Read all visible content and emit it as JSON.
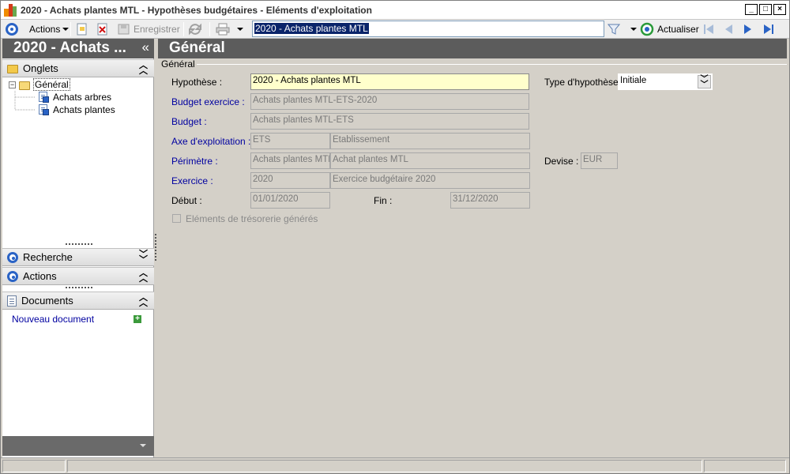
{
  "window": {
    "title": "2020 - Achats plantes MTL -  Hypothèses budgétaires - Eléments d'exploitation"
  },
  "toolbar": {
    "actions_label": "Actions",
    "save_label": "Enregistrer",
    "record_value": "2020 - Achats plantes MTL",
    "refresh_label": "Actualiser"
  },
  "left": {
    "header_title": "2020 - Achats ...",
    "collapse_glyph": "«",
    "tabs_section": "Onglets",
    "tree": {
      "root": "Général",
      "children": [
        "Achats arbres",
        "Achats plantes"
      ]
    },
    "search_section": "Recherche",
    "actions_section": "Actions",
    "documents_section": "Documents",
    "new_document": "Nouveau document"
  },
  "main": {
    "header_title": "Général",
    "group_label": "Général",
    "fields": {
      "hypothese": {
        "label": "Hypothèse :",
        "value": "2020 - Achats plantes MTL"
      },
      "type_hypothese": {
        "label": "Type d'hypothèse :",
        "value": "Initiale"
      },
      "budget_exercice": {
        "label": "Budget exercice :",
        "value": "Achats plantes MTL-ETS-2020"
      },
      "budget": {
        "label": "Budget :",
        "value": "Achats plantes MTL-ETS"
      },
      "axe": {
        "label": "Axe d'exploitation :",
        "code": "ETS",
        "name": "Etablissement"
      },
      "perimetre": {
        "label": "Périmètre :",
        "code": "Achats plantes MTL",
        "name": "Achat plantes MTL"
      },
      "devise": {
        "label": "Devise :",
        "value": "EUR"
      },
      "exercice": {
        "label": "Exercice :",
        "code": "2020",
        "name": "Exercice budgétaire 2020"
      },
      "debut": {
        "label": "Début :",
        "value": "01/01/2020"
      },
      "fin": {
        "label": "Fin :",
        "value": "31/12/2020"
      }
    },
    "checkbox_label": "Eléments de trésorerie générés",
    "checkbox_checked": false
  }
}
